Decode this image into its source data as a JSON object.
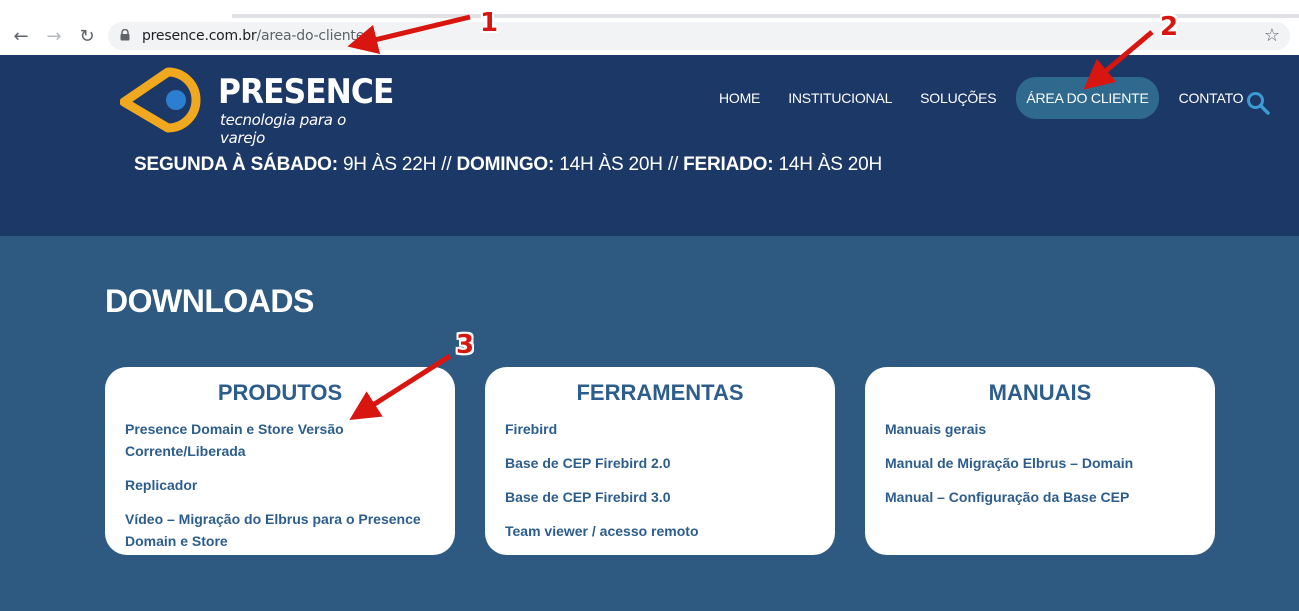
{
  "browser": {
    "url_host": "presence.com.br",
    "url_path": "/area-do-cliente/",
    "icons": {
      "back": "arrow-left-icon",
      "forward": "arrow-right-icon",
      "reload": "reload-icon",
      "secure": "lock-icon",
      "bookmark": "star-icon"
    }
  },
  "header": {
    "logo_word": "PRESENCE",
    "logo_tagline": "tecnologia para o varejo",
    "nav": [
      {
        "label": "HOME"
      },
      {
        "label": "INSTITUCIONAL"
      },
      {
        "label": "SOLUÇÕES"
      },
      {
        "label": "ÁREA DO CLIENTE",
        "active": true
      },
      {
        "label": "CONTATO"
      }
    ],
    "hours": {
      "mon_sat_label": "SEGUNDA À SÁBADO:",
      "mon_sat_value": " 9H ÀS 22H // ",
      "sunday_label": "DOMINGO:",
      "sunday_value": " 14H ÀS 20H // ",
      "holiday_label": "FERIADO:",
      "holiday_value": " 14H ÀS 20H"
    }
  },
  "downloads": {
    "title": "DOWNLOADS",
    "cards": [
      {
        "title": "PRODUTOS",
        "items": [
          "Presence Domain e Store Versão Corrente/Liberada",
          "Replicador",
          "Vídeo – Migração do Elbrus para o Presence Domain e Store"
        ]
      },
      {
        "title": "FERRAMENTAS",
        "items": [
          "Firebird",
          "Base de CEP Firebird 2.0",
          "Base de CEP Firebird 3.0",
          "Team viewer / acesso remoto"
        ]
      },
      {
        "title": "MANUAIS",
        "items": [
          "Manuais gerais",
          "Manual de Migração Elbrus – Domain",
          "Manual – Configuração da Base CEP"
        ]
      }
    ]
  },
  "annotations": [
    "1",
    "2",
    "3"
  ],
  "colors": {
    "header_bg": "#1c3866",
    "body_bg": "#2e5a82",
    "active_nav": "#2f6a8e",
    "card_text": "#2c5d8c",
    "logo_orange": "#f0a81e",
    "annotation_red": "#d8150f"
  }
}
